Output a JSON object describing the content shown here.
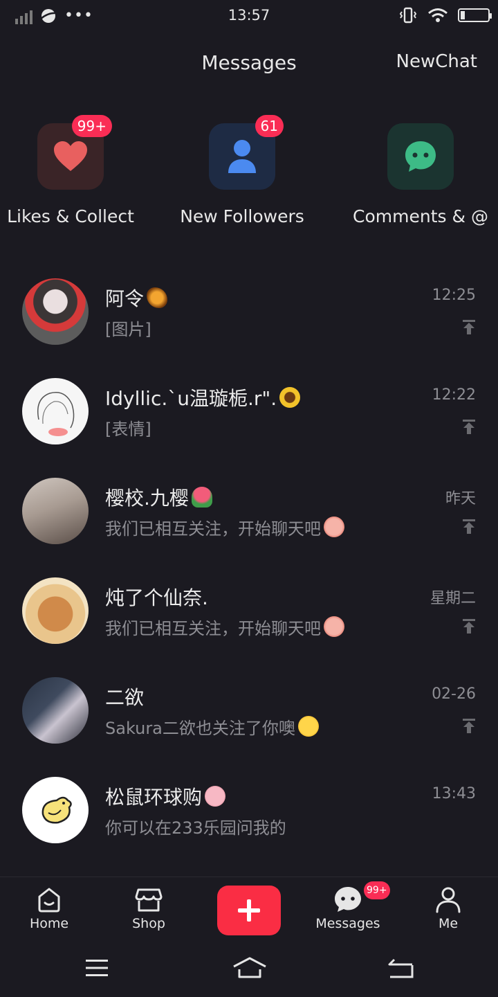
{
  "status_bar": {
    "time": "13:57"
  },
  "header": {
    "title": "Messages",
    "new_chat": "NewChat"
  },
  "categories": [
    {
      "label": "Likes & Collect",
      "badge": "99+",
      "icon": "heart-icon",
      "color": "#e8605f"
    },
    {
      "label": "New Followers",
      "badge": "61",
      "icon": "person-icon",
      "color": "#4b8af0"
    },
    {
      "label": "Comments & @",
      "badge": "",
      "icon": "chat-bubble-icon",
      "color": "#3dbb86"
    }
  ],
  "messages": [
    {
      "name": "阿令",
      "preview": "[图片]",
      "time": "12:25",
      "emoji": "butterfly"
    },
    {
      "name": "Idyllic.`u温璇栀.r\".",
      "preview": "[表情]",
      "time": "12:22",
      "emoji": "sunflower"
    },
    {
      "name": "樱校.九樱",
      "preview": "我们已相互关注，开始聊天吧",
      "time": "昨天",
      "emoji": "tulip",
      "preview_emoji": "peach-face"
    },
    {
      "name": "炖了个仙奈.",
      "preview": "我们已相互关注，开始聊天吧",
      "time": "星期二",
      "preview_emoji": "peach-face"
    },
    {
      "name": "二欲",
      "preview": "Sakura二欲也关注了你噢",
      "time": "02-26",
      "preview_emoji": "wink-face"
    },
    {
      "name": "松鼠环球购",
      "preview": "你可以在233乐园问我的",
      "time": "13:43",
      "emoji": "pig-face"
    }
  ],
  "bottom_nav": {
    "home": "Home",
    "shop": "Shop",
    "messages": "Messages",
    "messages_badge": "99+",
    "me": "Me"
  },
  "colors": {
    "background": "#1b1a21",
    "accent": "#fa2d44",
    "badge": "#fa2d55"
  }
}
